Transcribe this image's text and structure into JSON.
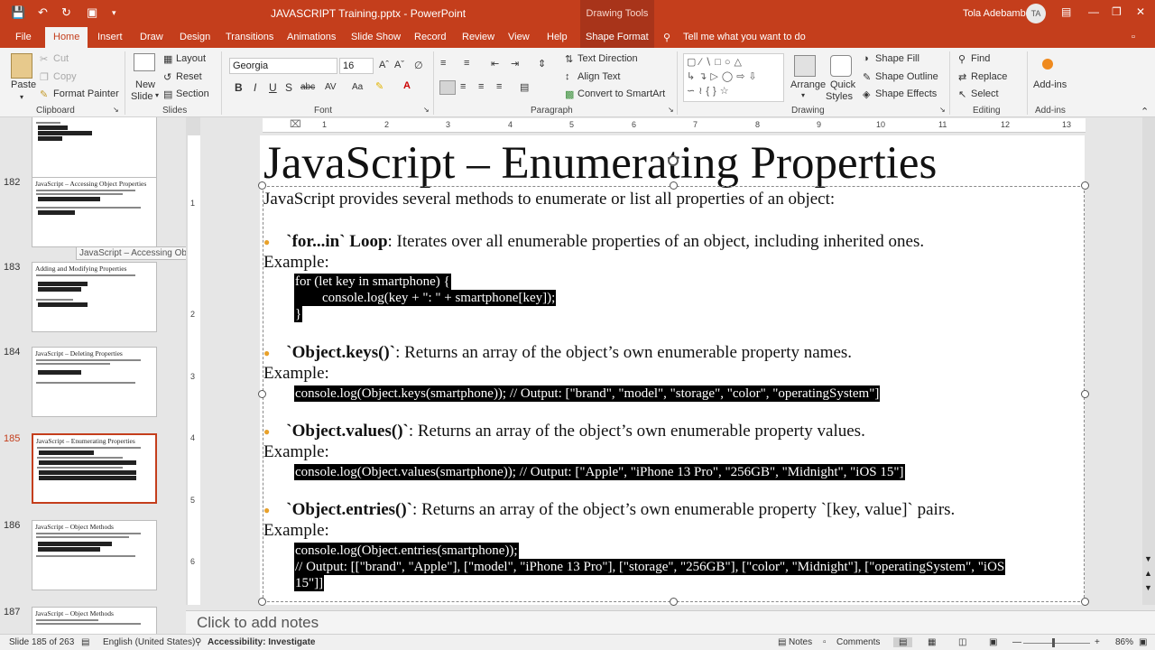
{
  "titlebar": {
    "doc_title": "JAVASCRIPT Training.pptx  -  PowerPoint",
    "context_title": "Drawing Tools",
    "user": "Tola Adebambo",
    "avatar": "TA"
  },
  "tabs": [
    "File",
    "Home",
    "Insert",
    "Draw",
    "Design",
    "Transitions",
    "Animations",
    "Slide Show",
    "Record",
    "Review",
    "View",
    "Help",
    "Shape Format"
  ],
  "active_tab": "Home",
  "tell_me": "Tell me what you want to do",
  "ribbon": {
    "clipboard": {
      "paste": "Paste",
      "cut": "Cut",
      "copy": "Copy",
      "format_painter": "Format Painter",
      "label": "Clipboard"
    },
    "slides": {
      "new_slide_1": "New",
      "new_slide_2": "Slide",
      "layout": "Layout",
      "reset": "Reset",
      "section": "Section",
      "label": "Slides"
    },
    "font": {
      "family": "Georgia",
      "size": "16",
      "label": "Font",
      "bold": "B",
      "italic": "I",
      "underline": "U",
      "strike": "S",
      "shadow": "abc",
      "spacing": "AV",
      "case": "Aa"
    },
    "paragraph": {
      "text_direction": "Text Direction",
      "align_text": "Align Text",
      "smartart": "Convert to SmartArt",
      "label": "Paragraph"
    },
    "drawing": {
      "arrange": "Arrange",
      "quick_styles_1": "Quick",
      "quick_styles_2": "Styles",
      "fill": "Shape Fill",
      "outline": "Shape Outline",
      "effects": "Shape Effects",
      "label": "Drawing"
    },
    "editing": {
      "find": "Find",
      "replace": "Replace",
      "select": "Select",
      "label": "Editing"
    },
    "addins": {
      "addins": "Add-ins",
      "label": "Add-ins"
    }
  },
  "thumbnails": [
    {
      "num": "182",
      "title": "JavaScript – Accessing Object Properties",
      "active": false
    },
    {
      "num": "183",
      "title": "Adding and Modifying Properties",
      "active": false
    },
    {
      "num": "184",
      "title": "JavaScript – Deleting Properties",
      "active": false
    },
    {
      "num": "185",
      "title": "JavaScript – Enumerating Properties",
      "active": true
    },
    {
      "num": "186",
      "title": "JavaScript – Object Methods",
      "active": false
    },
    {
      "num": "187",
      "title": "JavaScript – Object Methods",
      "active": false
    }
  ],
  "tooltip": "JavaScript – Accessing Object Pro...",
  "ruler_h": [
    "1",
    "2",
    "3",
    "4",
    "5",
    "6",
    "7",
    "8",
    "9",
    "10",
    "11",
    "12",
    "13"
  ],
  "ruler_v": [
    "1",
    "2",
    "3",
    "4",
    "5",
    "6"
  ],
  "slide": {
    "title": "JavaScript – Enumerating Properties",
    "intro": "JavaScript provides several methods to enumerate or list all properties of an object:",
    "example_label": "Example:",
    "b1_head": "`for...in` Loop",
    "b1_rest": ": Iterates over all enumerable properties of an object, including inherited ones.",
    "b1_code1": "for (let key in smartphone) {",
    "b1_code2": "        console.log(key + \": \" + smartphone[key]);",
    "b1_code3": "}",
    "b2_head": "`Object.keys()`",
    "b2_rest": ": Returns an array of the object’s own enumerable property names.",
    "b2_code": "console.log(Object.keys(smartphone)); // Output: [\"brand\", \"model\", \"storage\", \"color\", \"operatingSystem\"]",
    "b3_head": "`Object.values()`",
    "b3_rest": ": Returns an array of the object’s own enumerable property values.",
    "b3_code": "console.log(Object.values(smartphone)); // Output: [\"Apple\", \"iPhone 13 Pro\", \"256GB\", \"Midnight\", \"iOS 15\"]",
    "b4_head": "`Object.entries()`",
    "b4_rest": ": Returns an array of the object’s own enumerable property `[key, value]` pairs.",
    "b4_code1": "console.log(Object.entries(smartphone));",
    "b4_code2": "// Output: [[\"brand\", \"Apple\"], [\"model\", \"iPhone 13 Pro\"], [\"storage\", \"256GB\"], [\"color\", \"Midnight\"], [\"operatingSystem\", \"iOS",
    "b4_code3": "15\"]]"
  },
  "notes_placeholder": "Click to add notes",
  "status": {
    "slide": "Slide 185 of 263",
    "language": "English (United States)",
    "accessibility": "Accessibility: Investigate",
    "notes": "Notes",
    "comments": "Comments",
    "zoom": "86%"
  },
  "colors": {
    "accent": "#c43e1c",
    "bullet": "#e8a12a"
  }
}
